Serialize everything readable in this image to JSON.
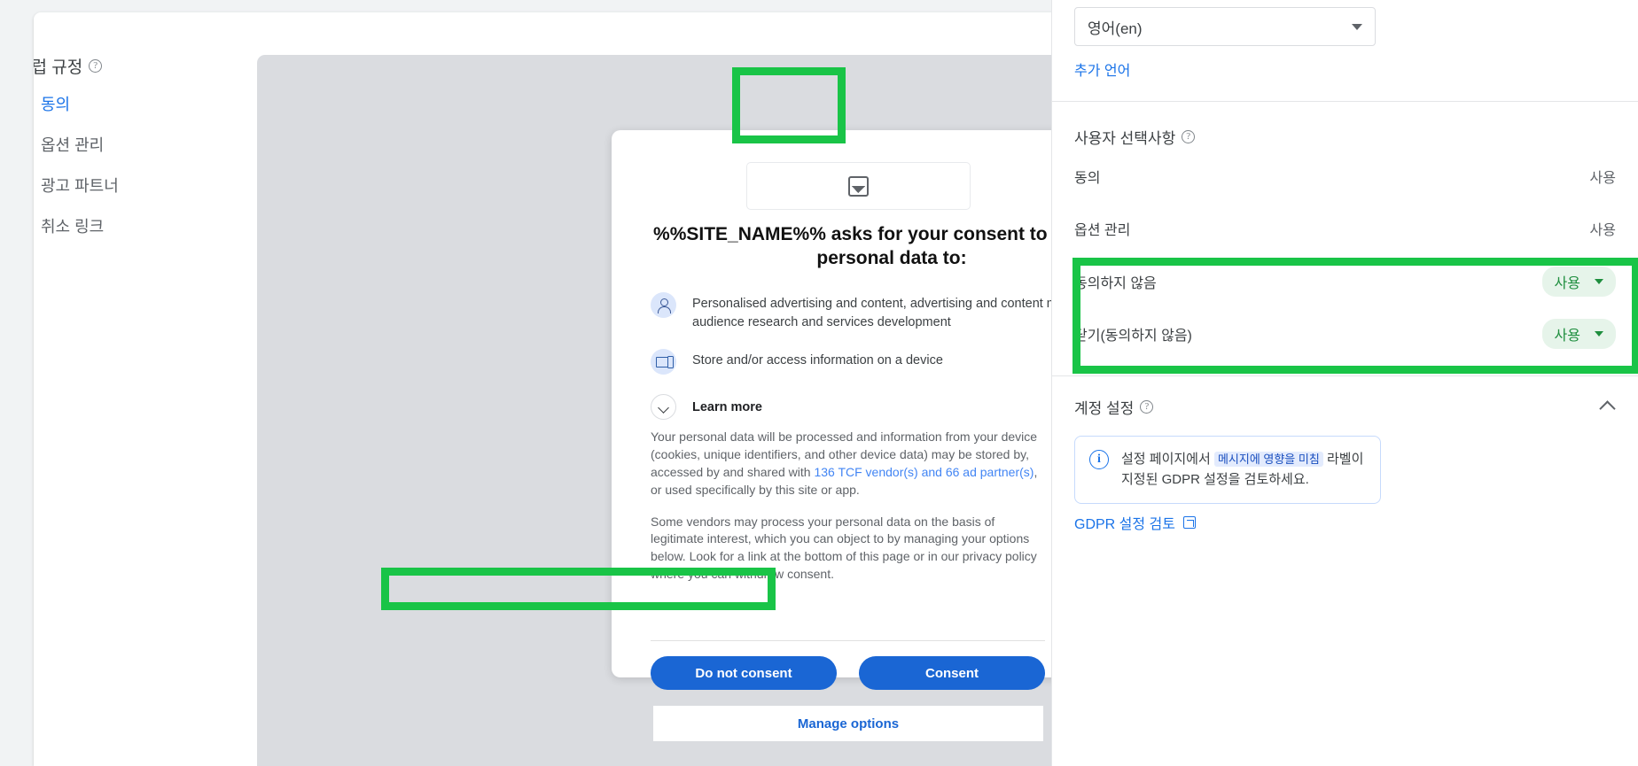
{
  "left_nav": {
    "section_title": "유럽 규정",
    "help_glyph": "?",
    "items": [
      {
        "label": "동의"
      },
      {
        "label": "옵션 관리"
      },
      {
        "label": "광고 파트너"
      },
      {
        "label": "취소 링크"
      }
    ]
  },
  "dialog": {
    "close_glyph": "✕",
    "image_placeholder_name": "image-placeholder-icon",
    "title": "%%SITE_NAME%% asks for your consent to use your personal data to:",
    "purposes": [
      {
        "icon": "person-icon",
        "text": "Personalised advertising and content, advertising and content measurement, audience research and services development"
      },
      {
        "icon": "device-icon",
        "text": "Store and/or access information on a device"
      }
    ],
    "learn_more": "Learn more",
    "body_p1_before": "Your personal data will be processed and information from your device (cookies, unique identifiers, and other device data) may be stored by, accessed by and shared with ",
    "body_p1_link": "136 TCF vendor(s) and 66 ad partner(s)",
    "body_p1_after": ", or used specifically by this site or app.",
    "body_p2": "Some vendors may process your personal data on the basis of legitimate interest, which you can object to by managing your options below. Look for a link at the bottom of this page or in our privacy policy where you can withdraw consent.",
    "do_not_consent": "Do not consent",
    "consent": "Consent",
    "manage_options": "Manage options"
  },
  "right_panel": {
    "language_value": "영어(en)",
    "add_language": "추가 언어",
    "user_choices": {
      "title": "사용자 선택사항",
      "help_glyph": "?",
      "rows": [
        {
          "label": "동의",
          "value": "사용",
          "type": "text"
        },
        {
          "label": "옵션 관리",
          "value": "사용",
          "type": "text"
        },
        {
          "label": "동의하지 않음",
          "value": "사용",
          "type": "pill"
        },
        {
          "label": "닫기(동의하지 않음)",
          "value": "사용",
          "type": "pill"
        }
      ]
    },
    "account_settings": {
      "title": "계정 설정",
      "help_glyph": "?",
      "info_before": "설정 페이지에서 ",
      "info_chip": "메시지에 영향을 미침",
      "info_after": " 라벨이 지정된 GDPR 설정을 검토하세요.",
      "info_icon_glyph": "i",
      "gdpr_link": "GDPR 설정 검토"
    }
  },
  "colors": {
    "highlight": "#19c447",
    "accent_blue": "#1a73e8",
    "button_blue": "#1a66d4",
    "pill_green_text": "#1e8e3e",
    "pill_green_bg": "#e6f4ea"
  }
}
